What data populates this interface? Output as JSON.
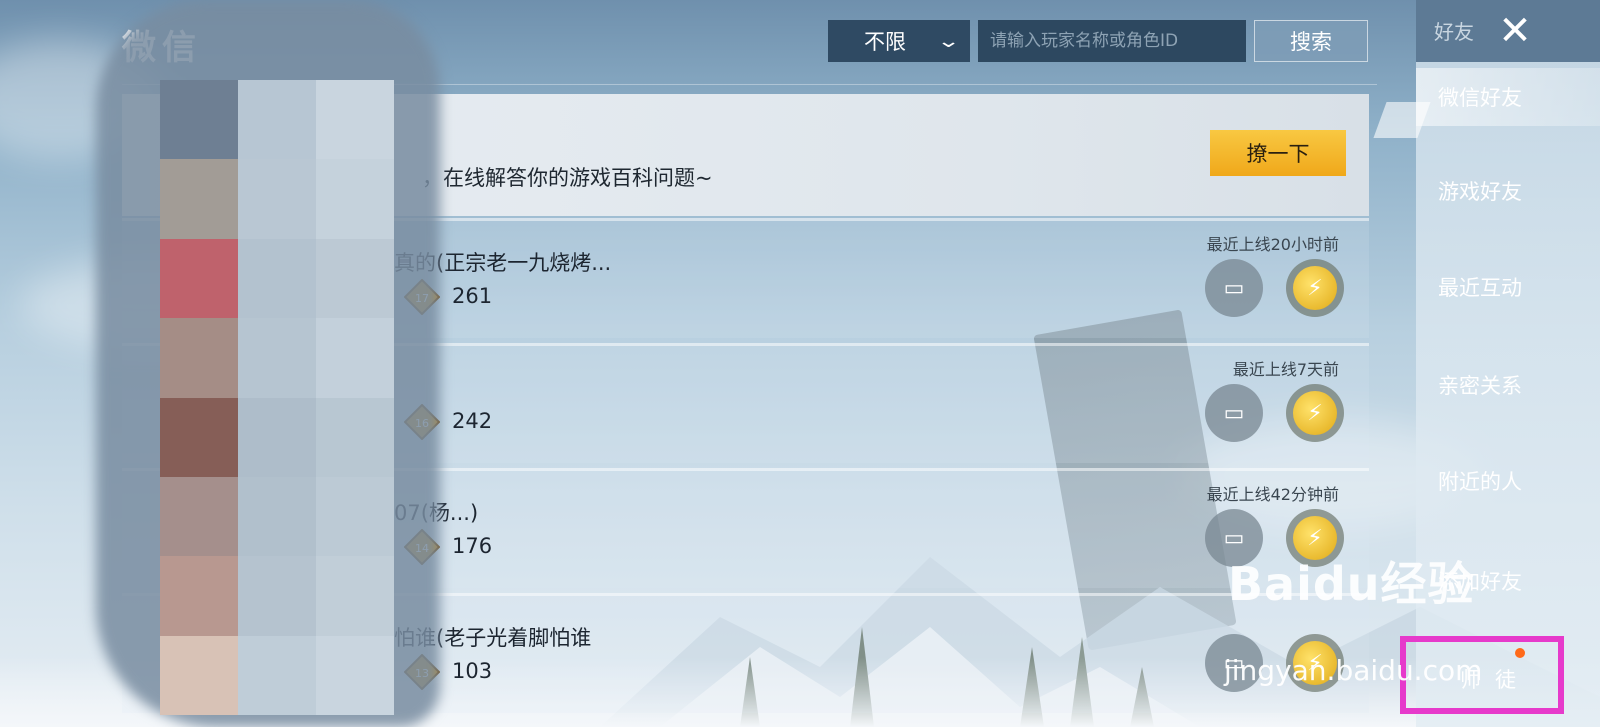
{
  "header": {
    "title": "微信",
    "filter_value": "不限",
    "search_placeholder": "请输入玩家名称或角色ID",
    "search_label": "搜索"
  },
  "banner": {
    "text": "，在线解答你的游戏百科问题~",
    "action_label": "撩一下"
  },
  "friends": [
    {
      "name": "真的(正宗老一九烧烤...",
      "tier": "17",
      "score": "261",
      "last_online": "最近上线20小时前"
    },
    {
      "name": "",
      "tier": "16",
      "score": "242",
      "last_online": "最近上线7天前"
    },
    {
      "name": "07(杨...)",
      "tier": "14",
      "score": "176",
      "last_online": "最近上线42分钟前"
    },
    {
      "name": "怕谁(老子光着脚怕谁",
      "tier": "13",
      "score": "103",
      "last_online": ""
    }
  ],
  "sidebar": {
    "header_label": "好友",
    "close_icon": "close-icon",
    "items": [
      {
        "label": "微信好友",
        "active": true
      },
      {
        "label": "游戏好友",
        "active": false
      },
      {
        "label": "最近互动",
        "active": false
      },
      {
        "label": "亲密关系",
        "active": false
      },
      {
        "label": "附近的人",
        "active": false
      },
      {
        "label": "添加好友",
        "active": false
      },
      {
        "label": "师徒",
        "active": false
      }
    ]
  },
  "watermark": {
    "logo": "Baidu经验",
    "url": "jingyan.baidu.com"
  },
  "colors": {
    "accent_gold": "#f0a81a",
    "highlight_box": "#e63acb",
    "notification_dot": "#ff6a1a"
  }
}
